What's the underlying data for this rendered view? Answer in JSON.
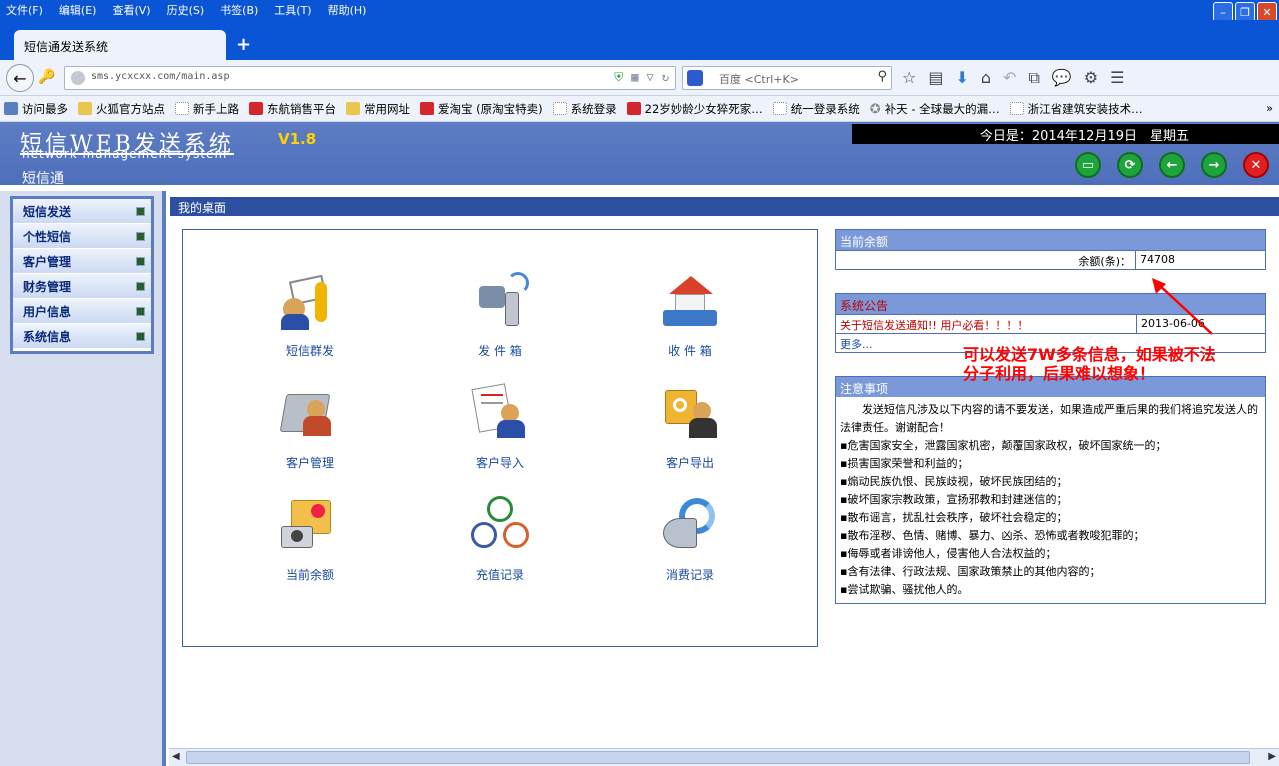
{
  "browser": {
    "menu": [
      "文件(F)",
      "编辑(E)",
      "查看(V)",
      "历史(S)",
      "书签(B)",
      "工具(T)",
      "帮助(H)"
    ],
    "tab_title": "短信通发送系统",
    "new_tab": "+",
    "url": "sms.ycxcxx.com/main.asp",
    "search_placeholder": "百度 <Ctrl+K>",
    "bookmarks": [
      {
        "label": "访问最多",
        "icon": "blue"
      },
      {
        "label": "火狐官方站点",
        "icon": "folder"
      },
      {
        "label": "新手上路",
        "icon": "page"
      },
      {
        "label": "东航销售平台",
        "icon": "red"
      },
      {
        "label": "常用网址",
        "icon": "folder"
      },
      {
        "label": "爱淘宝 (原淘宝特卖)",
        "icon": "red"
      },
      {
        "label": "系统登录",
        "icon": "page"
      },
      {
        "label": "22岁妙龄少女猝死家…",
        "icon": "red"
      },
      {
        "label": "统一登录系统",
        "icon": "page"
      },
      {
        "label": "补天 - 全球最大的漏…",
        "icon": "star"
      },
      {
        "label": "浙江省建筑安装技术…",
        "icon": "page"
      }
    ],
    "bookmarks_more": "»"
  },
  "header": {
    "title": "短信WEB发送系统",
    "version": "V1.8",
    "subtitle": "network management system",
    "shortname": "短信通",
    "date_text": "今日是：2014年12月19日　星期五"
  },
  "sidebar": {
    "items": [
      "短信发送",
      "个性短信",
      "客户管理",
      "财务管理",
      "用户信息",
      "系统信息"
    ]
  },
  "main": {
    "title": "我的桌面",
    "desktop": [
      {
        "label": "短信群发",
        "icon": "envelope-phone"
      },
      {
        "label": "发 件 箱",
        "icon": "outbox"
      },
      {
        "label": "收 件 箱",
        "icon": "inbox-house"
      },
      {
        "label": "客户管理",
        "icon": "customer-folder"
      },
      {
        "label": "客户导入",
        "icon": "customer-import"
      },
      {
        "label": "客户导出",
        "icon": "customer-export"
      },
      {
        "label": "当前余额",
        "icon": "camera-folder"
      },
      {
        "label": "充值记录",
        "icon": "clocks"
      },
      {
        "label": "消费记录",
        "icon": "ie-speaker"
      }
    ]
  },
  "balance": {
    "head": "当前余额",
    "label": "余额(条)：",
    "value": "74708"
  },
  "notice": {
    "head": "系统公告",
    "item_text": "关于短信发送通知!! 用户必看！！！！",
    "item_date": "2013-06-06",
    "more": "更多..."
  },
  "rules": {
    "head": "注意事项",
    "intro": "　　发送短信凡涉及以下内容的请不要发送，如果造成严重后果的我们将追究发送人的法律责任。谢谢配合！",
    "items": [
      "▪危害国家安全，泄露国家机密，颠覆国家政权，破坏国家统一的；",
      "▪损害国家荣誉和利益的；",
      "▪煽动民族仇恨、民族歧视，破坏民族团结的；",
      "▪破坏国家宗教政策，宣扬邪教和封建迷信的；",
      "▪散布谣言，扰乱社会秩序，破坏社会稳定的；",
      "▪散布淫秽、色情、赌博、暴力、凶杀、恐怖或者教唆犯罪的；",
      "▪侮辱或者诽谤他人，侵害他人合法权益的；",
      "▪含有法律、行政法规、国家政策禁止的其他内容的；",
      "▪尝试欺骗、骚扰他人的。"
    ]
  },
  "annotation": {
    "line1": "可以发送7W多条信息，如果被不法",
    "line2": "分子利用，后果难以想象！",
    "color": "#ff0000"
  }
}
